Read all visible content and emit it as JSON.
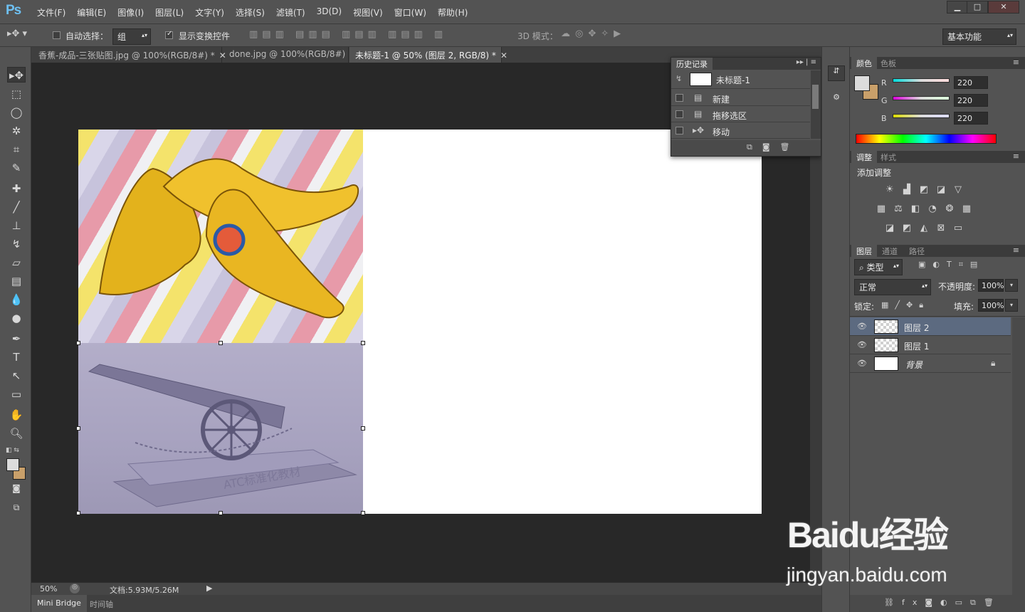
{
  "app": {
    "logo": "Ps"
  },
  "menu": [
    "文件(F)",
    "编辑(E)",
    "图像(I)",
    "图层(L)",
    "文字(Y)",
    "选择(S)",
    "滤镜(T)",
    "3D(D)",
    "视图(V)",
    "窗口(W)",
    "帮助(H)"
  ],
  "window_controls": {
    "minimize": "▁",
    "restore": "□",
    "close": "✕"
  },
  "options": {
    "auto_select_label": "自动选择：",
    "auto_select_value": "组",
    "auto_select_checked": false,
    "show_transform_label": "显示变换控件",
    "show_transform_checked": true,
    "mode_3d_label": "3D 模式：",
    "workspace": "基本功能"
  },
  "tabs": [
    {
      "label": "香蕉-成品-三张贴图.jpg @ 100%(RGB/8#) *",
      "active": false
    },
    {
      "label": "done.jpg @ 100%(RGB/8#)",
      "active": false
    },
    {
      "label": "未标题-1 @ 50% (图层 2, RGB/8) *",
      "active": true
    }
  ],
  "canvas_images": {
    "cannon_text": "ATC标准化教材"
  },
  "history": {
    "tabs": [
      "历史记录"
    ],
    "snapshot": "未标题-1",
    "items": [
      "新建",
      "拖移选区",
      "移动"
    ]
  },
  "color_panel": {
    "tabs": [
      "颜色",
      "色板"
    ],
    "r_label": "R",
    "g_label": "G",
    "b_label": "B",
    "r": "220",
    "g": "220",
    "b": "220",
    "foreground": "#dcdcdc",
    "background": "#c9a06a"
  },
  "adjust_panel": {
    "tabs": [
      "调整",
      "样式"
    ],
    "title": "添加调整"
  },
  "layers_panel": {
    "tabs": [
      "图层",
      "通道",
      "路径"
    ],
    "filter_kind": "类型",
    "blend_mode": "正常",
    "opacity_label": "不透明度:",
    "opacity": "100%",
    "lock_label": "锁定:",
    "fill_label": "填充:",
    "fill": "100%",
    "layers": [
      {
        "name": "图层 2",
        "selected": true
      },
      {
        "name": "图层 1",
        "selected": false
      },
      {
        "name": "背景",
        "selected": false,
        "locked": true
      }
    ]
  },
  "status": {
    "zoom": "50%",
    "doc": "文档:5.93M/5.26M"
  },
  "bottom_tabs": [
    "Mini Bridge",
    "时间轴"
  ],
  "watermark": {
    "logo": "Baidu经验",
    "url": "jingyan.baidu.com"
  }
}
